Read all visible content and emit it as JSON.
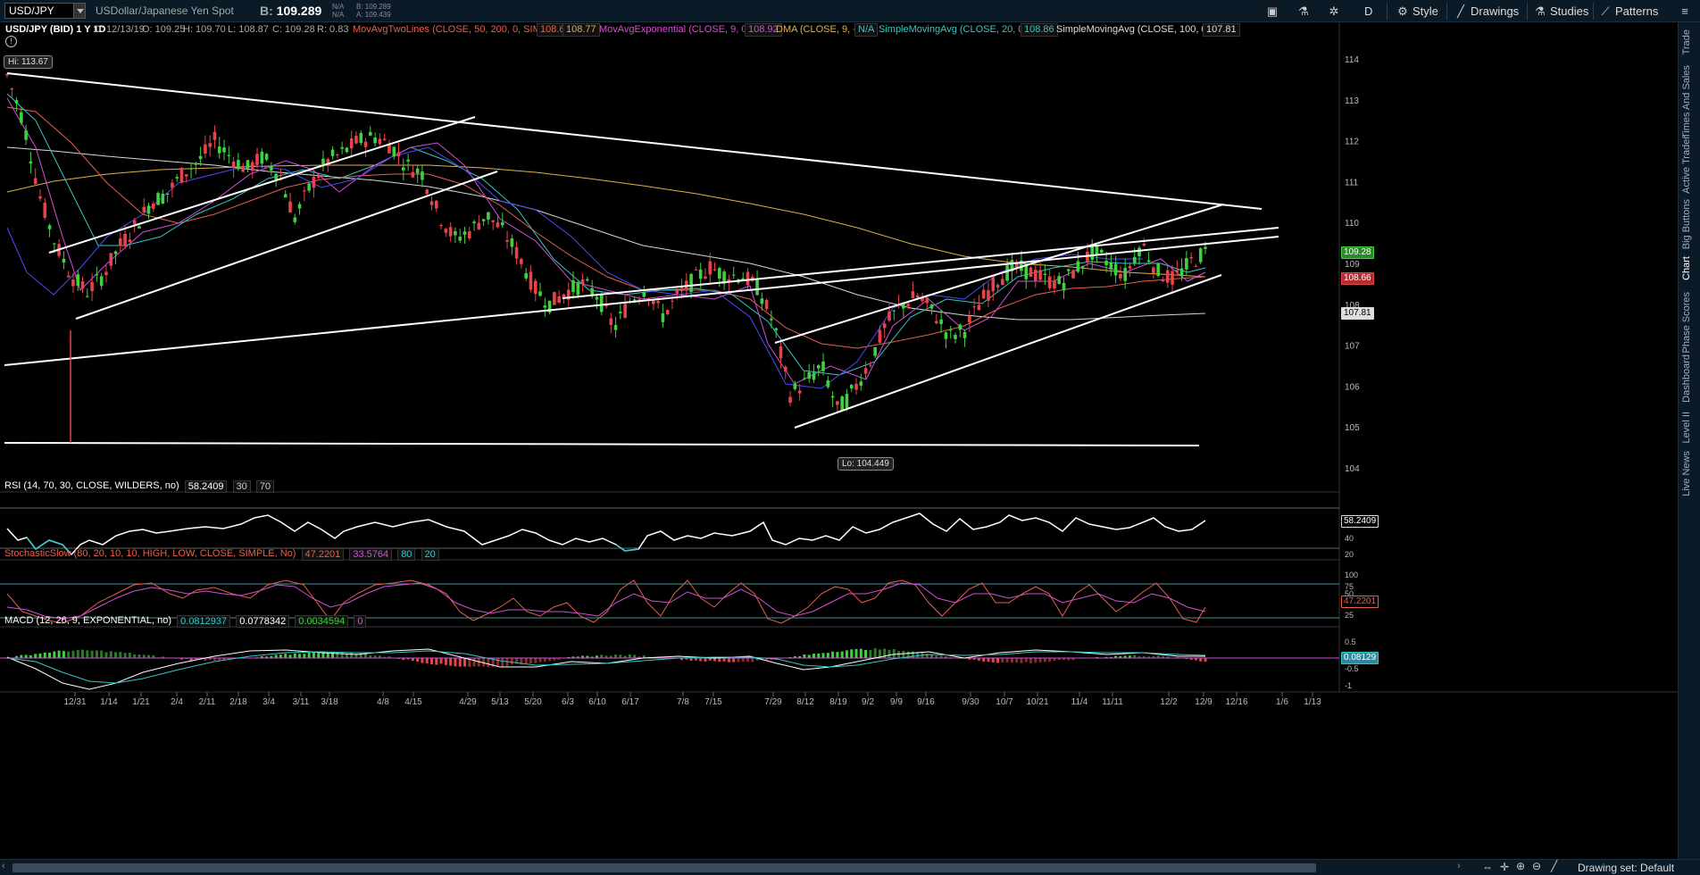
{
  "header": {
    "symbol": "USD/JPY",
    "description": "USDollar/Japanese Yen Spot",
    "bid_label": "B:",
    "bid_value": "109.289",
    "na1": "N/A",
    "na2": "N/A",
    "quote_b": "B: 109.289",
    "quote_a": "A: 109.439",
    "period_btn": "D",
    "style_btn": "Style",
    "drawings_btn": "Drawings",
    "studies_btn": "Studies",
    "patterns_btn": "Patterns"
  },
  "studybar": {
    "title": "USD/JPY (BID) 1 Y 1D",
    "date": "D: 12/13/19",
    "open": "O: 109.25",
    "high": "H: 109.70",
    "low": "L: 108.87",
    "close": "C: 109.28",
    "range": "R: 0.83",
    "s1": "MovAvgTwoLines (CLOSE, 50, 200, 0, SIMPLE)",
    "s1v1": "108.66",
    "s1v2": "108.77",
    "s2": "MovAvgExponential (CLOSE, 9, 0, no)",
    "s2v": "108.92",
    "s3": "DMA (CLOSE, 9, -14)",
    "s3v": "N/A",
    "s4": "SimpleMovingAvg (CLOSE, 20, 0, no)",
    "s4v": "108.86",
    "s5": "SimpleMovingAvg (CLOSE, 100, 0, no)",
    "s5v": "107.81"
  },
  "annotations": {
    "hi": "Hi: 113.67",
    "lo": "Lo: 104.449"
  },
  "price_tags": {
    "last": "109.28",
    "ma50": "108.66",
    "ma100": "107.81"
  },
  "rsi": {
    "label": "RSI (14, 70, 30, CLOSE, WILDERS, no)",
    "value": "58.2409",
    "ob": "30",
    "os": "70",
    "tag": "58.2409"
  },
  "stoch": {
    "label": "StochasticSlow (80, 20, 10, 10, HIGH, LOW, CLOSE, SIMPLE, No)",
    "k": "47.2201",
    "d": "33.5764",
    "hi": "80",
    "lo": "20",
    "tag": "47.2201"
  },
  "macd": {
    "label": "MACD (12, 26, 9, EXPONENTIAL, no)",
    "v": "0.0812937",
    "avg": "0.0778342",
    "diff": "0.0034594",
    "zero": "0",
    "tag": "0.08129"
  },
  "right_tabs": [
    "Trade",
    "Times And Sales",
    "Active Trader",
    "Big Buttons",
    "Chart",
    "Phase Scores",
    "Dashboard",
    "Level II",
    "Live News"
  ],
  "footer": {
    "drawing_set": "Drawing set: Default"
  },
  "chart_data": [
    {
      "type": "candlestick",
      "title": "USD/JPY (BID) 1 Y 1D",
      "x_ticks": [
        "12/31",
        "1/14",
        "1/21",
        "2/4",
        "2/11",
        "2/18",
        "3/4",
        "3/11",
        "3/18",
        "4/8",
        "4/15",
        "4/29",
        "5/13",
        "5/20",
        "6/3",
        "6/10",
        "6/17",
        "7/8",
        "7/15",
        "7/29",
        "8/12",
        "8/19",
        "9/2",
        "9/9",
        "9/16",
        "9/30",
        "10/7",
        "10/21",
        "11/4",
        "11/11",
        "12/2",
        "12/9",
        "12/16",
        "1/6",
        "1/13"
      ],
      "y_ticks": [
        104,
        105,
        106,
        107,
        108,
        109,
        110,
        111,
        112,
        113,
        114
      ],
      "ylim": [
        103.5,
        114.5
      ],
      "close_path": [
        113.6,
        112.5,
        110.7,
        109.5,
        108.7,
        108.3,
        108.7,
        109.4,
        109.9,
        110.5,
        110.7,
        111.2,
        111.5,
        112.0,
        111.6,
        111.3,
        111.6,
        111.2,
        110.1,
        110.9,
        111.5,
        111.7,
        112.0,
        112.1,
        111.9,
        111.4,
        111.2,
        110.2,
        109.6,
        109.8,
        110.2,
        109.8,
        109.2,
        108.4,
        108.0,
        108.3,
        108.5,
        108.2,
        107.4,
        108.1,
        108.4,
        107.7,
        108.2,
        108.6,
        108.9,
        108.7,
        108.7,
        108.4,
        107.5,
        105.8,
        106.1,
        106.5,
        105.4,
        105.9,
        106.6,
        107.5,
        108.0,
        108.2,
        107.8,
        107.2,
        107.4,
        108.1,
        108.6,
        108.9,
        108.8,
        108.6,
        108.5,
        108.9,
        109.3,
        109.0,
        108.7,
        109.5,
        108.8,
        108.6,
        109.0,
        109.28
      ],
      "series": [
        {
          "name": "MovAvgTwoLines (CLOSE, 50, 200, 0, SIMPLE)",
          "color": "#e8604c",
          "last": 108.66
        },
        {
          "name": "MovAvgExponential (CLOSE, 9, 0, no)",
          "color": "#d24fd6",
          "last": 108.92
        },
        {
          "name": "DMA (CLOSE, 9, -14)",
          "color": "#4a4aff"
        },
        {
          "name": "SimpleMovingAvg (CLOSE, 20, 0, no)",
          "color": "#34c7c7",
          "last": 108.86
        },
        {
          "name": "SimpleMovingAvg (CLOSE, 100, 0, no)",
          "color": "#d8d8d8",
          "last": 107.81
        }
      ]
    },
    {
      "type": "line",
      "title": "RSI (14, 70, 30, CLOSE, WILDERS, no)",
      "y_ticks": [
        20,
        40
      ],
      "last": 58.2409
    },
    {
      "type": "line",
      "title": "StochasticSlow",
      "y_ticks": [
        25,
        50,
        75,
        100
      ],
      "last": 47.2201
    },
    {
      "type": "bar",
      "title": "MACD (12, 26, 9, EXPONENTIAL, no)",
      "y_ticks": [
        0.5,
        0,
        -0.5,
        -1
      ],
      "last": 0.08129
    }
  ],
  "colors": {
    "up": "#3fd13f",
    "down": "#e8434a",
    "bg": "#000000",
    "toolbar": "#0b1a27"
  }
}
